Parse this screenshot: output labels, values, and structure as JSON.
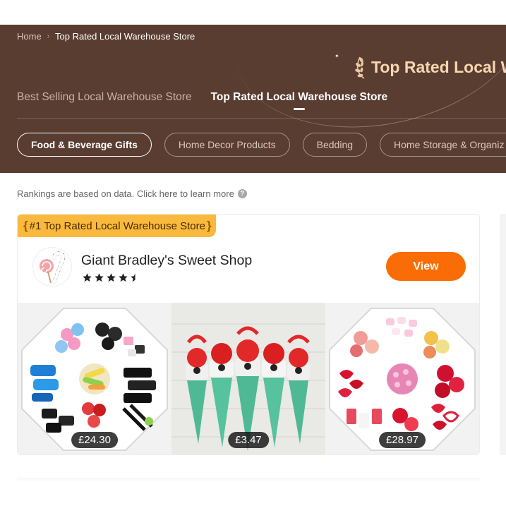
{
  "breadcrumb": {
    "home": "Home",
    "current": "Top Rated Local Warehouse Store"
  },
  "hero": {
    "title": "Top Rated Local W"
  },
  "tabs": [
    {
      "label": "Best Selling Local Warehouse Store",
      "active": false
    },
    {
      "label": "Top Rated Local Warehouse Store",
      "active": true
    }
  ],
  "categories": [
    {
      "label": "Food & Beverage Gifts",
      "active": true
    },
    {
      "label": "Home Decor Products",
      "active": false
    },
    {
      "label": "Bedding",
      "active": false
    },
    {
      "label": "Home Storage & Organiz",
      "active": false
    }
  ],
  "rankings_note": "Rankings are based on data. Click here to learn more",
  "store": {
    "rank_label": "#1 Top Rated Local Warehouse Store",
    "name": "Giant Bradley's Sweet Shop",
    "rating": 4.5,
    "view_label": "View",
    "products": [
      {
        "price": "£24.30",
        "image": "sweet-tray-mixed"
      },
      {
        "price": "£3.47",
        "image": "sweet-cones"
      },
      {
        "price": "£28.97",
        "image": "sweet-tray-pink-red"
      }
    ]
  },
  "colors": {
    "hero_bg": "#5a3d31",
    "title_gold": "#f6d7b0",
    "badge": "#f9b93c",
    "view_button": "#fa6d06"
  }
}
